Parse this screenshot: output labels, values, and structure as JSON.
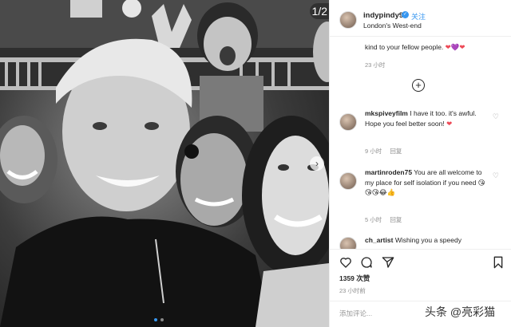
{
  "photo": {
    "counter": "1/2",
    "next_icon": "chevron-right-icon",
    "slides": 2,
    "active_slide": 1
  },
  "header": {
    "username": "indypindy9",
    "verified_icon": "verified-check-icon",
    "follow_label": "关注",
    "location": "London's West-end"
  },
  "post": {
    "caption_tail": "kind to your fellow people.",
    "hearts": "❤💜❤",
    "time": "23 小时"
  },
  "comments": [
    {
      "user": "mkspiveyfilm",
      "text": "I have it too. it's awful. Hope you feel better soon!",
      "emoji": "❤",
      "time": "9 小时",
      "reply": "回复"
    },
    {
      "user": "martinroden75",
      "text": "You are all welcome to my place for self isolation if you need",
      "emoji": "😘😘😘😂👍",
      "time": "5 小时",
      "reply": "回复"
    },
    {
      "user": "ch_artist",
      "text": "Wishing you a speedy"
    }
  ],
  "actions": {
    "likes_count": "1359",
    "likes_label": "次赞",
    "date": "23 小时前",
    "add_comment_placeholder": "添加评论..."
  },
  "watermark": "头条 @亮彩猫",
  "colors": {
    "accent": "#3897f0",
    "heart": "#ed4956",
    "meta_grey": "#8e8e8e",
    "border": "#efefef"
  }
}
